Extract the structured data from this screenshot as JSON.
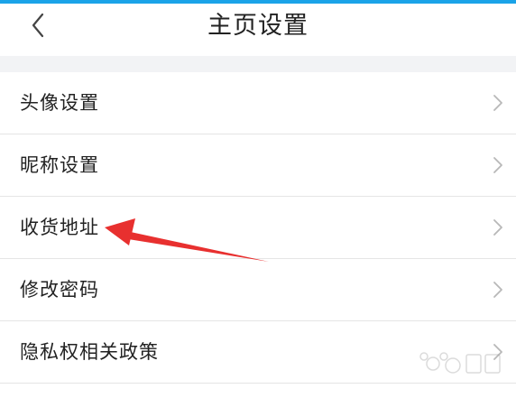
{
  "header": {
    "title": "主页设置",
    "back_icon": "chevron-left-icon"
  },
  "settings": {
    "items": [
      {
        "label": "头像设置",
        "icon": "chevron-right-icon"
      },
      {
        "label": "昵称设置",
        "icon": "chevron-right-icon"
      },
      {
        "label": "收货地址",
        "icon": "chevron-right-icon"
      },
      {
        "label": "修改密码",
        "icon": "chevron-right-icon"
      },
      {
        "label": "隐私权相关政策",
        "icon": "chevron-right-icon"
      }
    ]
  },
  "annotation": {
    "arrow_color": "#e8302f",
    "target": "收货地址"
  },
  "colors": {
    "accent": "#1aa3e8",
    "divider": "#e5e5e5",
    "text": "#222222",
    "chevron": "#b8b8b8"
  }
}
